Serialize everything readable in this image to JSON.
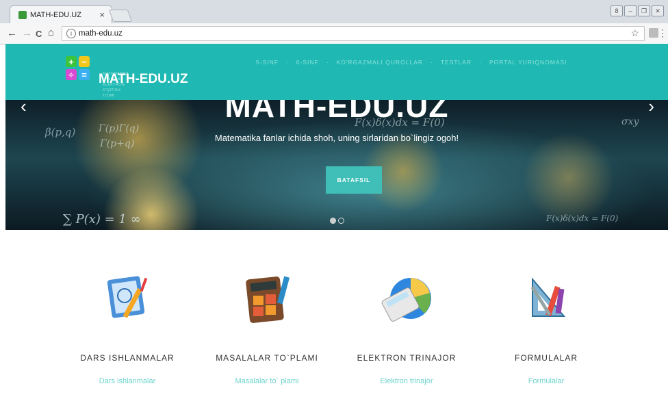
{
  "browser": {
    "tab_title": "MATH-EDU.UZ",
    "tab_close": "×",
    "url": "math-edu.uz",
    "back": "←",
    "forward": "→",
    "reload": "C",
    "home": "⌂",
    "star": "☆",
    "window_controls": [
      "8",
      "–",
      "❐",
      "✕"
    ]
  },
  "header": {
    "logo_tagline_1": "MATEMATIKA FANIDAN",
    "logo_tagline_2": "ELEKTRON O'QITISH TIZIMI",
    "logo_title": "MATH-EDU.UZ",
    "nav": [
      "5-SINF",
      "6-SINF",
      "KO'RGAZMALI QUROLLAR",
      "TESTLAR",
      "PORTAL YURIQNOMASI"
    ],
    "nav_separator": "·"
  },
  "hero": {
    "title": "MATH-EDU.UZ",
    "subtitle": "Matematika fanlar ichida shoh, uning sirlaridan bo`lingiz ogoh!",
    "button": "BATAFSIL",
    "prev": "‹",
    "next": "›"
  },
  "features": [
    {
      "title": "DARS ISHLANMALAR",
      "link": "Dars ishlanmalar",
      "icon": "lesson-plans-icon"
    },
    {
      "title": "MASALALAR TO`PLAMI",
      "link": "Masalalar to` plami",
      "icon": "calculator-icon"
    },
    {
      "title": "ELEKTRON TRINAJOR",
      "link": "Elektron trinajor",
      "icon": "trainer-calculator-icon"
    },
    {
      "title": "FORMULALAR",
      "link": "Formulalar",
      "icon": "geometry-tools-icon"
    }
  ],
  "colors": {
    "teal": "#1fb8b2",
    "button": "#3fbfb7",
    "link": "#6fd4cd"
  }
}
